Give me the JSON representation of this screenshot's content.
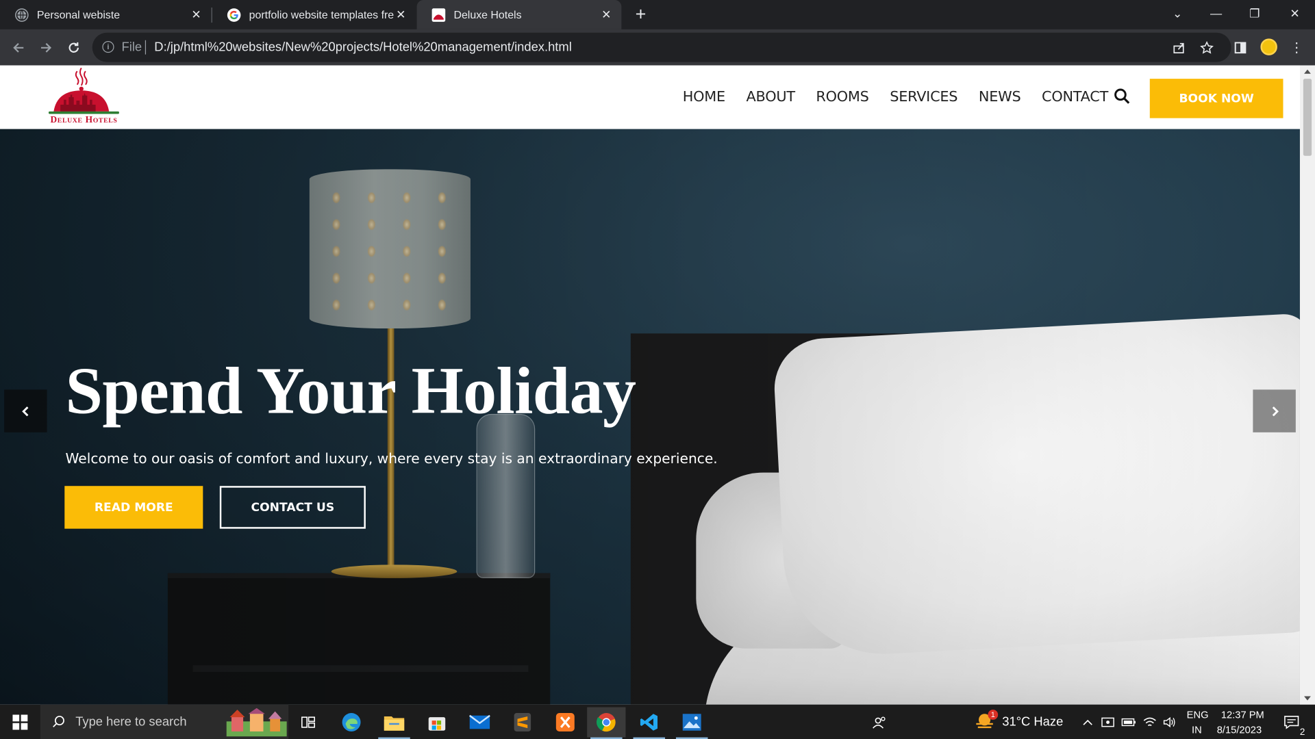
{
  "browser": {
    "tabs": [
      {
        "title": "Personal webiste",
        "active": false
      },
      {
        "title": "portfolio website templates free",
        "active": false
      },
      {
        "title": "Deluxe Hotels",
        "active": true
      }
    ],
    "address": {
      "scheme_label": "File",
      "url": "D:/jp/html%20websites/New%20projects/Hotel%20management/index.html"
    }
  },
  "site": {
    "logo_text": "Deluxe Hotels",
    "nav": [
      "HOME",
      "ABOUT",
      "ROOMS",
      "SERVICES",
      "NEWS",
      "CONTACT"
    ],
    "book_label": "BOOK NOW",
    "hero": {
      "title": "Spend Your Holiday",
      "subtitle": "Welcome to our oasis of comfort and luxury, where every stay is an extraordinary experience.",
      "read_more": "READ MORE",
      "contact_us": "CONTACT US"
    },
    "colors": {
      "accent": "#fbbc07",
      "logo_red": "#c8102e"
    }
  },
  "taskbar": {
    "search_placeholder": "Type here to search",
    "weather": "31°C  Haze",
    "weather_badge": "1",
    "lang_top": "ENG",
    "lang_bottom": "IN",
    "time": "12:37 PM",
    "date": "8/15/2023",
    "notifications": "2",
    "apps": [
      "task-view",
      "edge",
      "file-explorer",
      "microsoft-store",
      "mail",
      "sublime-text",
      "xampp",
      "chrome",
      "vscode",
      "photos"
    ]
  }
}
